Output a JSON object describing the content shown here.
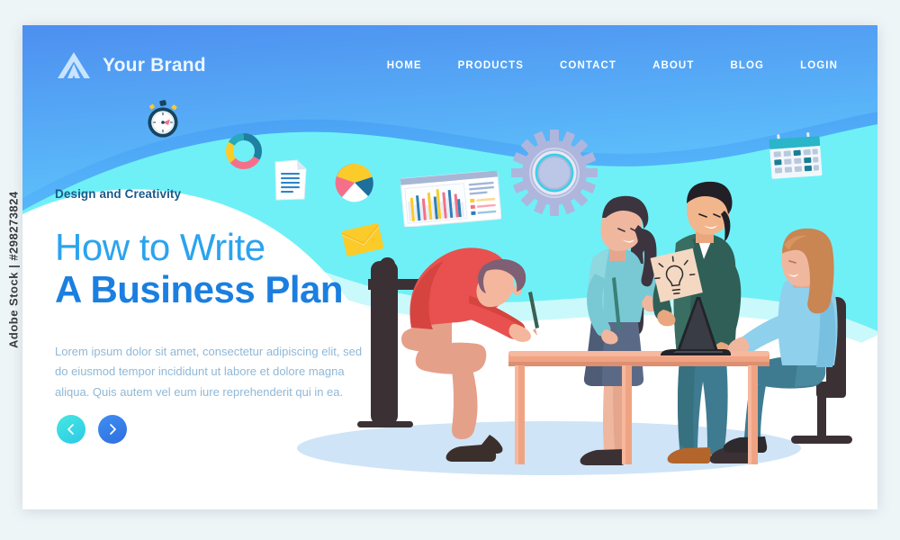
{
  "watermark": {
    "side_label": "Adobe Stock | #298273824"
  },
  "header": {
    "brand_name": "Your Brand",
    "logo_icon": "mountain-chevron-logo-icon",
    "nav": [
      {
        "label": "HOME"
      },
      {
        "label": "PRODUCTS"
      },
      {
        "label": "CONTACT"
      },
      {
        "label": "ABOUT"
      },
      {
        "label": "BLOG"
      },
      {
        "label": "LOGIN"
      }
    ]
  },
  "hero": {
    "eyebrow": "Design and Creativity",
    "title_line1": "How to Write",
    "title_line2": "A Business Plan",
    "paragraph": "Lorem ipsum dolor sit amet, consectetur adipiscing elit, sed do eiusmod tempor incididunt ut labore et dolore magna aliqua. Quis autem vel eum iure reprehenderit qui in ea.",
    "prev_label": "‹",
    "next_label": "›",
    "prev_icon": "chevron-left-icon",
    "next_icon": "chevron-right-icon"
  },
  "floating_icons": [
    {
      "name": "stopwatch-icon"
    },
    {
      "name": "donut-chart-icon"
    },
    {
      "name": "document-icon"
    },
    {
      "name": "pie-chart-icon"
    },
    {
      "name": "envelope-icon"
    },
    {
      "name": "bar-chart-dashboard-icon"
    },
    {
      "name": "gear-icon"
    },
    {
      "name": "calendar-icon"
    }
  ],
  "illustration": {
    "name": "business-team-meeting-illustration",
    "figures": [
      {
        "name": "seated-man-writing",
        "shirt": "#e8514f"
      },
      {
        "name": "standing-woman-with-pencil",
        "top": "#79c9d4",
        "skirt": "#5a6a86"
      },
      {
        "name": "standing-man-with-idea-sheet",
        "sweater": "#2f5f56"
      },
      {
        "name": "seated-woman-at-laptop",
        "top": "#8fd0ec"
      }
    ],
    "props": [
      {
        "name": "desk"
      },
      {
        "name": "office-chair-left"
      },
      {
        "name": "office-chair-right"
      },
      {
        "name": "laptop"
      },
      {
        "name": "lightbulb-sketch-sheet"
      },
      {
        "name": "floor-shadow-ellipse"
      }
    ]
  },
  "colors": {
    "brand_blue": "#2f8ae8",
    "sky_blue": "#4fb4f7",
    "cyan": "#6ef0f5",
    "light_cyan": "#a8eef5",
    "white": "#ffffff",
    "headline_light": "#2ba3f0",
    "headline_bold": "#1b7fe0",
    "eyebrow": "#1a5a8c",
    "body_text": "#8fb8d8",
    "accent_pink": "#f4708a",
    "accent_yellow": "#fbcb2a",
    "accent_teal": "#1f7fa0",
    "page_bg": "#eef5f7"
  }
}
